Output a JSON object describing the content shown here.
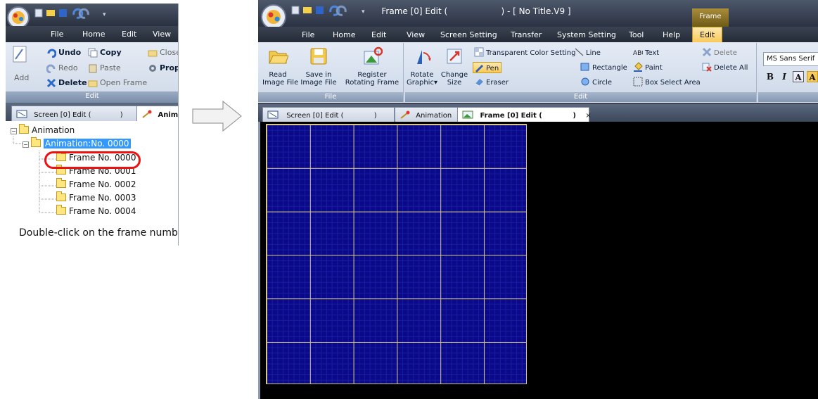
{
  "left_panel": {
    "menu": [
      "File",
      "Home",
      "Edit",
      "View"
    ],
    "ribbon": {
      "add_label": "Add",
      "undo_label": "Undo",
      "redo_label": "Redo",
      "delete_label": "Delete",
      "copy_label": "Copy",
      "paste_label": "Paste",
      "open_frame_label": "Open Frame",
      "close_label": "Close",
      "prop_label": "Prop",
      "group_caption": "Edit"
    },
    "tabs": [
      "Screen [0] Edit (",
      ")",
      "Anim"
    ],
    "tree": {
      "root": "Animation",
      "animation_node": "Animation:No. 0000",
      "frames": [
        "Frame No. 0000",
        "Frame No. 0001",
        "Frame No. 0002",
        "Frame No. 0003",
        "Frame No. 0004"
      ]
    },
    "caption": "Double-click on the frame number."
  },
  "window": {
    "title": "Frame [0] Edit (                    ) - [ No Title.V9 ]",
    "context_tab": "Frame",
    "menu": [
      "File",
      "Home",
      "Edit",
      "View",
      "Screen Setting",
      "Transfer",
      "System Setting",
      "Tool",
      "Help",
      "Edit"
    ],
    "ribbon": {
      "file_group": {
        "caption": "File",
        "read_line1": "Read",
        "read_line2": "Image File",
        "save_line1": "Save in",
        "save_line2": "Image File",
        "register_line1": "Register",
        "register_line2": "Rotating Frame"
      },
      "edit_group": {
        "caption": "Edit",
        "rotate_line1": "Rotate",
        "rotate_line2": "Graphic",
        "change_line1": "Change",
        "change_line2": "Size",
        "transparent": "Transparent Color Setting",
        "pen": "Pen",
        "eraser": "Eraser",
        "line": "Line",
        "rectangle": "Rectangle",
        "circle": "Circle",
        "text": "Text",
        "paint": "Paint",
        "box_select": "Box Select Area",
        "delete": "Delete",
        "delete_all": "Delete All"
      },
      "font_group": {
        "font_name": "MS Sans Serif",
        "bold": "B",
        "italic": "I",
        "boxed": "A"
      }
    },
    "doc_tabs": {
      "screen": "Screen [0] Edit (",
      "screen_close": ")",
      "animation": "Animation",
      "frame": "Frame [0] Edit (",
      "frame_close": ")",
      "close_x": "×"
    }
  }
}
